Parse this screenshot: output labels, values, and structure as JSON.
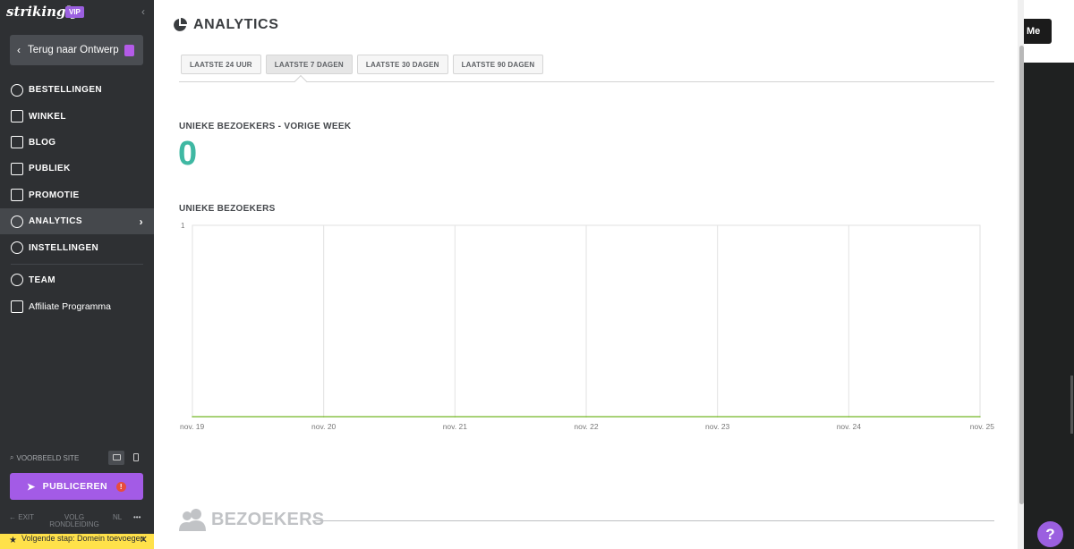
{
  "sidebar": {
    "brand": "strikingly",
    "vip_badge": "VIP",
    "back_button": "Terug naar Ontwerp",
    "items": [
      {
        "label": "BESTELLINGEN",
        "icon": "dollar-circle-icon"
      },
      {
        "label": "WINKEL",
        "icon": "store-icon"
      },
      {
        "label": "BLOG",
        "icon": "pen-icon"
      },
      {
        "label": "PUBLIEK",
        "icon": "users-icon"
      },
      {
        "label": "PROMOTIE",
        "icon": "megaphone-icon"
      },
      {
        "label": "ANALYTICS",
        "icon": "pie-chart-icon",
        "active": true
      },
      {
        "label": "INSTELLINGEN",
        "icon": "gear-icon"
      }
    ],
    "extra_items": [
      {
        "label": "TEAM",
        "icon": "team-icon"
      },
      {
        "label": "Affiliate Programma",
        "icon": "trophy-icon"
      }
    ],
    "preview_label": "VOORBEELD SITE",
    "publish_button": "PUBLICEREN",
    "publish_alert": "!",
    "footer": {
      "exit": "EXIT",
      "tour": "VOLG RONDLEIDING",
      "lang": "NL",
      "more": "•••"
    },
    "next_step": "Volgende stap: Domein toevoegen"
  },
  "main": {
    "title": "ANALYTICS",
    "tabs": [
      {
        "label": "LAATSTE 24 UUR",
        "active": false
      },
      {
        "label": "LAATSTE 7 DAGEN",
        "active": true
      },
      {
        "label": "LAATSTE 30 DAGEN",
        "active": false
      },
      {
        "label": "LAATSTE 90 DAGEN",
        "active": false
      }
    ],
    "weekly_label": "UNIEKE BEZOEKERS - VORIGE WEEK",
    "weekly_value": "0",
    "chart_label": "UNIEKE BEZOEKERS",
    "visitors_section": "BEZOEKERS"
  },
  "chart_data": {
    "type": "line",
    "title": "UNIEKE BEZOEKERS",
    "categories": [
      "nov. 19",
      "nov. 20",
      "nov. 21",
      "nov. 22",
      "nov. 23",
      "nov. 24",
      "nov. 25"
    ],
    "series": [
      {
        "values": [
          0,
          0,
          0,
          0,
          0,
          0,
          0
        ]
      }
    ],
    "ylim": [
      0,
      1
    ],
    "y_ticks": [
      "1"
    ],
    "grid": true,
    "line_color": "#8bc34a"
  },
  "right_edge": {
    "button_text": "Me",
    "help": "?"
  },
  "colors": {
    "sidebar": "#2e3033",
    "accent": "#a35be6",
    "teal": "#3fb8a3"
  }
}
